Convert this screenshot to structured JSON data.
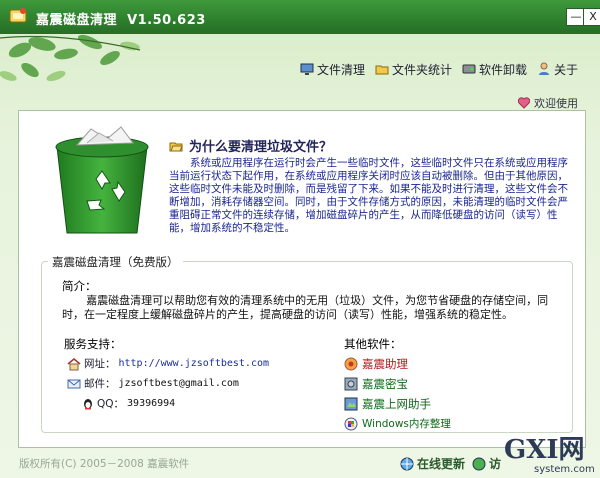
{
  "window": {
    "title": "嘉震磁盘清理",
    "version": "V1.50.623",
    "minimize_glyph": "—",
    "close_glyph": "X"
  },
  "nav": {
    "items": [
      {
        "label": "文件清理",
        "icon": "monitor-icon"
      },
      {
        "label": "文件夹统计",
        "icon": "folder-icon"
      },
      {
        "label": "软件卸载",
        "icon": "disk-icon"
      },
      {
        "label": "关于",
        "icon": "user-icon"
      }
    ]
  },
  "welcome": "欢迎使用",
  "why": {
    "title": "为什么要清理垃圾文件？",
    "body": "系统或应用程序在运行时会产生一些临时文件，这些临时文件只在系统或应用程序当前运行状态下起作用，在系统或应用程序关闭时应该自动被删除。但由于其他原因，这些临时文件未能及时删除，而是残留了下来。如果不能及时进行清理，这些文件会不断增加，消耗存储器空间。同时，由于文件存储方式的原因，未能清理的临时文件会严重阻碍正常文件的连续存储，增加磁盘碎片的产生，从而降低硬盘的访问（读写）性能，增加系统的不稳定性。"
  },
  "info": {
    "legend": "嘉震磁盘清理（免费版）",
    "intro_label": "简介：",
    "intro_text": "嘉震磁盘清理可以帮助您有效的清理系统中的无用（垃圾）文件，为您节省硬盘的存储空间，同时，在一定程度上缓解磁盘碎片的产生，提高硬盘的访问（读写）性能，增强系统的稳定性。",
    "service_title": "服务支持：",
    "website_label": "网址：",
    "website": "http://www.jzsoftbest.com",
    "email_label": "邮件：",
    "email": "jzsoftbest@gmail.com",
    "qq_label": "QQ：",
    "qq": "39396994",
    "other_title": "其他软件：",
    "other": [
      "嘉震助理",
      "嘉震密宝",
      "嘉震上网助手",
      "Windows内存整理"
    ]
  },
  "footer": {
    "copyright": "版权所有(C) 2005－2008 嘉震软件",
    "update": "在线更新",
    "visit": "访"
  },
  "watermark": {
    "brand": "GXI网",
    "domain": "system.com"
  },
  "colors": {
    "title_bar": "#2e7f2d",
    "accent_green": "#2c5a2c",
    "body_blue": "#1b2790"
  }
}
